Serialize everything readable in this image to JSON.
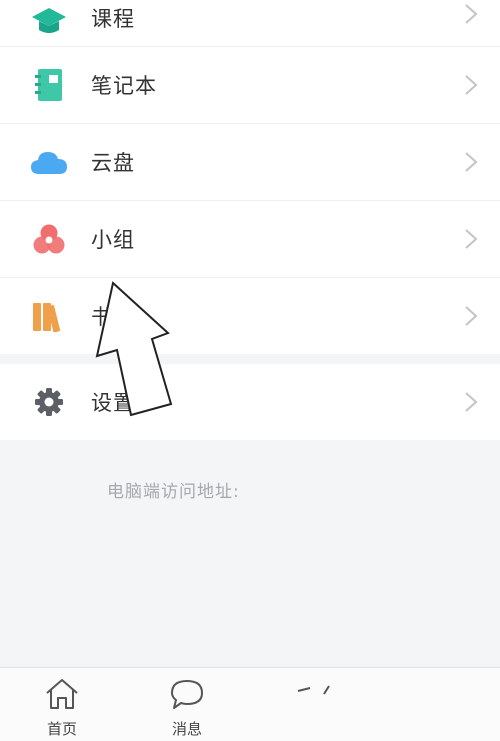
{
  "menu": {
    "items": [
      {
        "label": "课程",
        "icon": "graduation-cap-icon",
        "color": "#22b89a"
      },
      {
        "label": "笔记本",
        "icon": "notebook-icon",
        "color": "#3ec8a8"
      },
      {
        "label": "云盘",
        "icon": "cloud-icon",
        "color": "#4aa9f0"
      },
      {
        "label": "小组",
        "icon": "group-circles-icon",
        "color": "#ef6e6e"
      },
      {
        "label": "书架",
        "icon": "bookshelf-icon",
        "color": "#f0a04b"
      }
    ],
    "settings": {
      "label": "设置",
      "icon": "gear-icon",
      "color": "#5c5f66"
    }
  },
  "footer": {
    "access_label": "电脑端访问地址:"
  },
  "tabbar": {
    "tabs": [
      {
        "label": "首页",
        "icon": "home-icon"
      },
      {
        "label": "消息",
        "icon": "chat-bubble-icon"
      }
    ]
  }
}
